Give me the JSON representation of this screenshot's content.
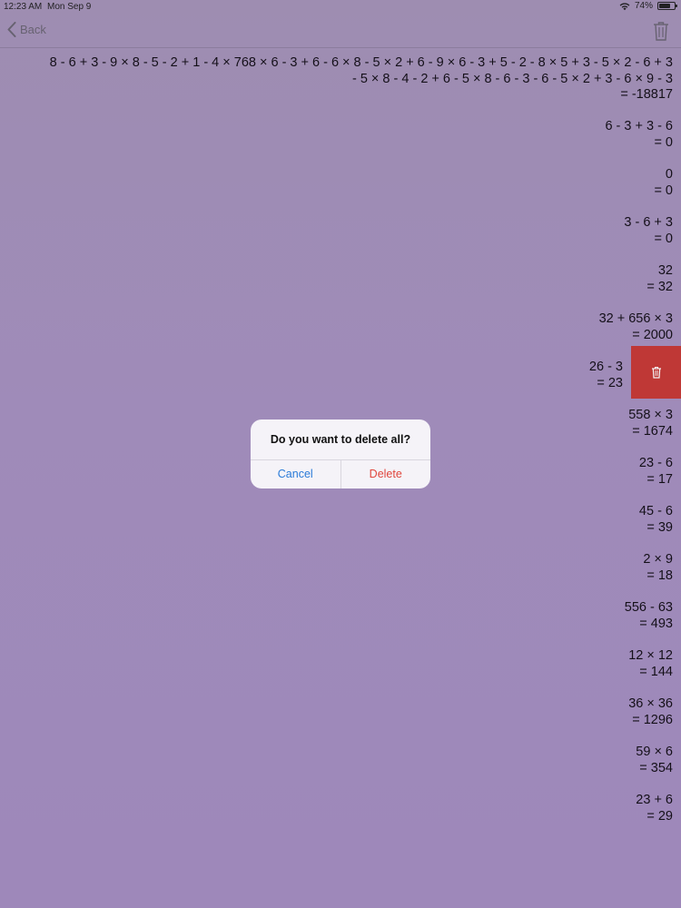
{
  "status_bar": {
    "time": "12:23 AM",
    "date": "Mon Sep 9",
    "battery": "74%",
    "battery_level": 0.74
  },
  "nav": {
    "back_label": "Back"
  },
  "history": [
    {
      "lines": [
        "8 - 6 + 3 - 9 × 8 - 5 - 2 + 1 - 4 × 768 × 6 - 3 + 6 - 6 × 8 - 5 × 2 + 6 - 9 × 6 - 3 + 5 - 2 - 8 × 5 + 3 - 5 × 2 - 6 + 3",
        "- 5 × 8 - 4 - 2 + 6 - 5 × 8 - 6 - 3 - 6 - 5 × 2 + 3 - 6 × 9 - 3"
      ],
      "result": "= -18817"
    },
    {
      "lines": [
        "6 - 3 + 3 - 6"
      ],
      "result": "= 0"
    },
    {
      "lines": [
        "0"
      ],
      "result": "= 0"
    },
    {
      "lines": [
        "3 - 6 + 3"
      ],
      "result": "= 0"
    },
    {
      "lines": [
        "32"
      ],
      "result": "= 32"
    },
    {
      "lines": [
        "32 + 656 × 3"
      ],
      "result": "= 2000"
    },
    {
      "lines": [
        "26 - 3"
      ],
      "result": "= 23"
    },
    {
      "lines": [
        "558 × 3"
      ],
      "result": "= 1674"
    },
    {
      "lines": [
        "23 - 6"
      ],
      "result": "= 17"
    },
    {
      "lines": [
        "45 - 6"
      ],
      "result": "= 39"
    },
    {
      "lines": [
        "2 × 9"
      ],
      "result": "= 18"
    },
    {
      "lines": [
        "556 - 63"
      ],
      "result": "= 493"
    },
    {
      "lines": [
        "12 × 12"
      ],
      "result": "= 144"
    },
    {
      "lines": [
        "36 × 36"
      ],
      "result": "= 1296"
    },
    {
      "lines": [
        "59 × 6"
      ],
      "result": "= 354"
    },
    {
      "lines": [
        "23 + 6"
      ],
      "result": "= 29"
    }
  ],
  "alert": {
    "title": "Do you want to delete all?",
    "cancel_label": "Cancel",
    "delete_label": "Delete"
  },
  "colors": {
    "delete_red": "#c83a36",
    "cancel_blue": "#2a7bd8",
    "destructive_text": "#e0463c"
  }
}
